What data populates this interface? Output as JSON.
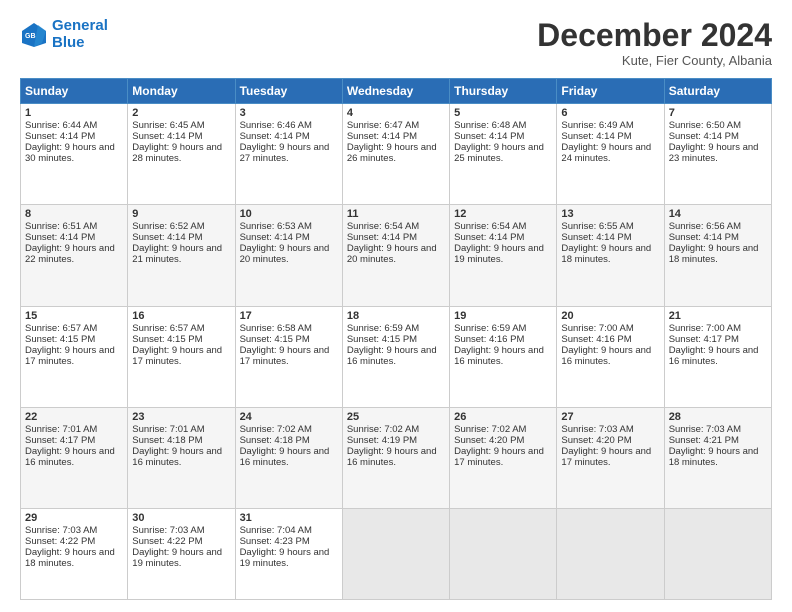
{
  "logo": {
    "line1": "General",
    "line2": "Blue"
  },
  "title": "December 2024",
  "subtitle": "Kute, Fier County, Albania",
  "days_of_week": [
    "Sunday",
    "Monday",
    "Tuesday",
    "Wednesday",
    "Thursday",
    "Friday",
    "Saturday"
  ],
  "weeks": [
    [
      {
        "num": "1",
        "sunrise": "6:44 AM",
        "sunset": "4:14 PM",
        "daylight": "9 hours and 30 minutes."
      },
      {
        "num": "2",
        "sunrise": "6:45 AM",
        "sunset": "4:14 PM",
        "daylight": "9 hours and 28 minutes."
      },
      {
        "num": "3",
        "sunrise": "6:46 AM",
        "sunset": "4:14 PM",
        "daylight": "9 hours and 27 minutes."
      },
      {
        "num": "4",
        "sunrise": "6:47 AM",
        "sunset": "4:14 PM",
        "daylight": "9 hours and 26 minutes."
      },
      {
        "num": "5",
        "sunrise": "6:48 AM",
        "sunset": "4:14 PM",
        "daylight": "9 hours and 25 minutes."
      },
      {
        "num": "6",
        "sunrise": "6:49 AM",
        "sunset": "4:14 PM",
        "daylight": "9 hours and 24 minutes."
      },
      {
        "num": "7",
        "sunrise": "6:50 AM",
        "sunset": "4:14 PM",
        "daylight": "9 hours and 23 minutes."
      }
    ],
    [
      {
        "num": "8",
        "sunrise": "6:51 AM",
        "sunset": "4:14 PM",
        "daylight": "9 hours and 22 minutes."
      },
      {
        "num": "9",
        "sunrise": "6:52 AM",
        "sunset": "4:14 PM",
        "daylight": "9 hours and 21 minutes."
      },
      {
        "num": "10",
        "sunrise": "6:53 AM",
        "sunset": "4:14 PM",
        "daylight": "9 hours and 20 minutes."
      },
      {
        "num": "11",
        "sunrise": "6:54 AM",
        "sunset": "4:14 PM",
        "daylight": "9 hours and 20 minutes."
      },
      {
        "num": "12",
        "sunrise": "6:54 AM",
        "sunset": "4:14 PM",
        "daylight": "9 hours and 19 minutes."
      },
      {
        "num": "13",
        "sunrise": "6:55 AM",
        "sunset": "4:14 PM",
        "daylight": "9 hours and 18 minutes."
      },
      {
        "num": "14",
        "sunrise": "6:56 AM",
        "sunset": "4:14 PM",
        "daylight": "9 hours and 18 minutes."
      }
    ],
    [
      {
        "num": "15",
        "sunrise": "6:57 AM",
        "sunset": "4:15 PM",
        "daylight": "9 hours and 17 minutes."
      },
      {
        "num": "16",
        "sunrise": "6:57 AM",
        "sunset": "4:15 PM",
        "daylight": "9 hours and 17 minutes."
      },
      {
        "num": "17",
        "sunrise": "6:58 AM",
        "sunset": "4:15 PM",
        "daylight": "9 hours and 17 minutes."
      },
      {
        "num": "18",
        "sunrise": "6:59 AM",
        "sunset": "4:15 PM",
        "daylight": "9 hours and 16 minutes."
      },
      {
        "num": "19",
        "sunrise": "6:59 AM",
        "sunset": "4:16 PM",
        "daylight": "9 hours and 16 minutes."
      },
      {
        "num": "20",
        "sunrise": "7:00 AM",
        "sunset": "4:16 PM",
        "daylight": "9 hours and 16 minutes."
      },
      {
        "num": "21",
        "sunrise": "7:00 AM",
        "sunset": "4:17 PM",
        "daylight": "9 hours and 16 minutes."
      }
    ],
    [
      {
        "num": "22",
        "sunrise": "7:01 AM",
        "sunset": "4:17 PM",
        "daylight": "9 hours and 16 minutes."
      },
      {
        "num": "23",
        "sunrise": "7:01 AM",
        "sunset": "4:18 PM",
        "daylight": "9 hours and 16 minutes."
      },
      {
        "num": "24",
        "sunrise": "7:02 AM",
        "sunset": "4:18 PM",
        "daylight": "9 hours and 16 minutes."
      },
      {
        "num": "25",
        "sunrise": "7:02 AM",
        "sunset": "4:19 PM",
        "daylight": "9 hours and 16 minutes."
      },
      {
        "num": "26",
        "sunrise": "7:02 AM",
        "sunset": "4:20 PM",
        "daylight": "9 hours and 17 minutes."
      },
      {
        "num": "27",
        "sunrise": "7:03 AM",
        "sunset": "4:20 PM",
        "daylight": "9 hours and 17 minutes."
      },
      {
        "num": "28",
        "sunrise": "7:03 AM",
        "sunset": "4:21 PM",
        "daylight": "9 hours and 18 minutes."
      }
    ],
    [
      {
        "num": "29",
        "sunrise": "7:03 AM",
        "sunset": "4:22 PM",
        "daylight": "9 hours and 18 minutes."
      },
      {
        "num": "30",
        "sunrise": "7:03 AM",
        "sunset": "4:22 PM",
        "daylight": "9 hours and 19 minutes."
      },
      {
        "num": "31",
        "sunrise": "7:04 AM",
        "sunset": "4:23 PM",
        "daylight": "9 hours and 19 minutes."
      },
      null,
      null,
      null,
      null
    ]
  ]
}
